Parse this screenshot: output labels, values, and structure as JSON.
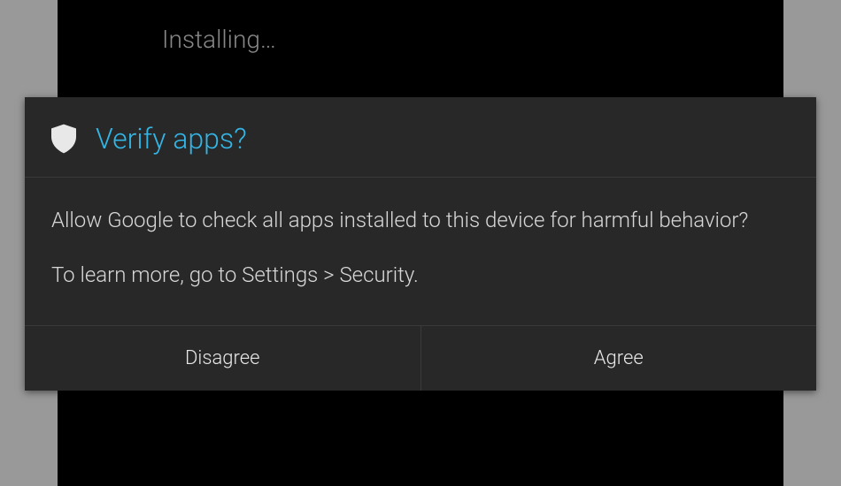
{
  "background": {
    "status_text": "Installing…"
  },
  "dialog": {
    "title": "Verify apps?",
    "message": "Allow Google to check all apps installed to this device for harmful behavior?",
    "hint": "To learn more, go to Settings > Security.",
    "buttons": {
      "negative": "Disagree",
      "positive": "Agree"
    }
  },
  "colors": {
    "accent": "#33b5e5",
    "dialog_bg": "#282828",
    "text_primary": "#d8d8d8",
    "text_muted": "#888888"
  }
}
